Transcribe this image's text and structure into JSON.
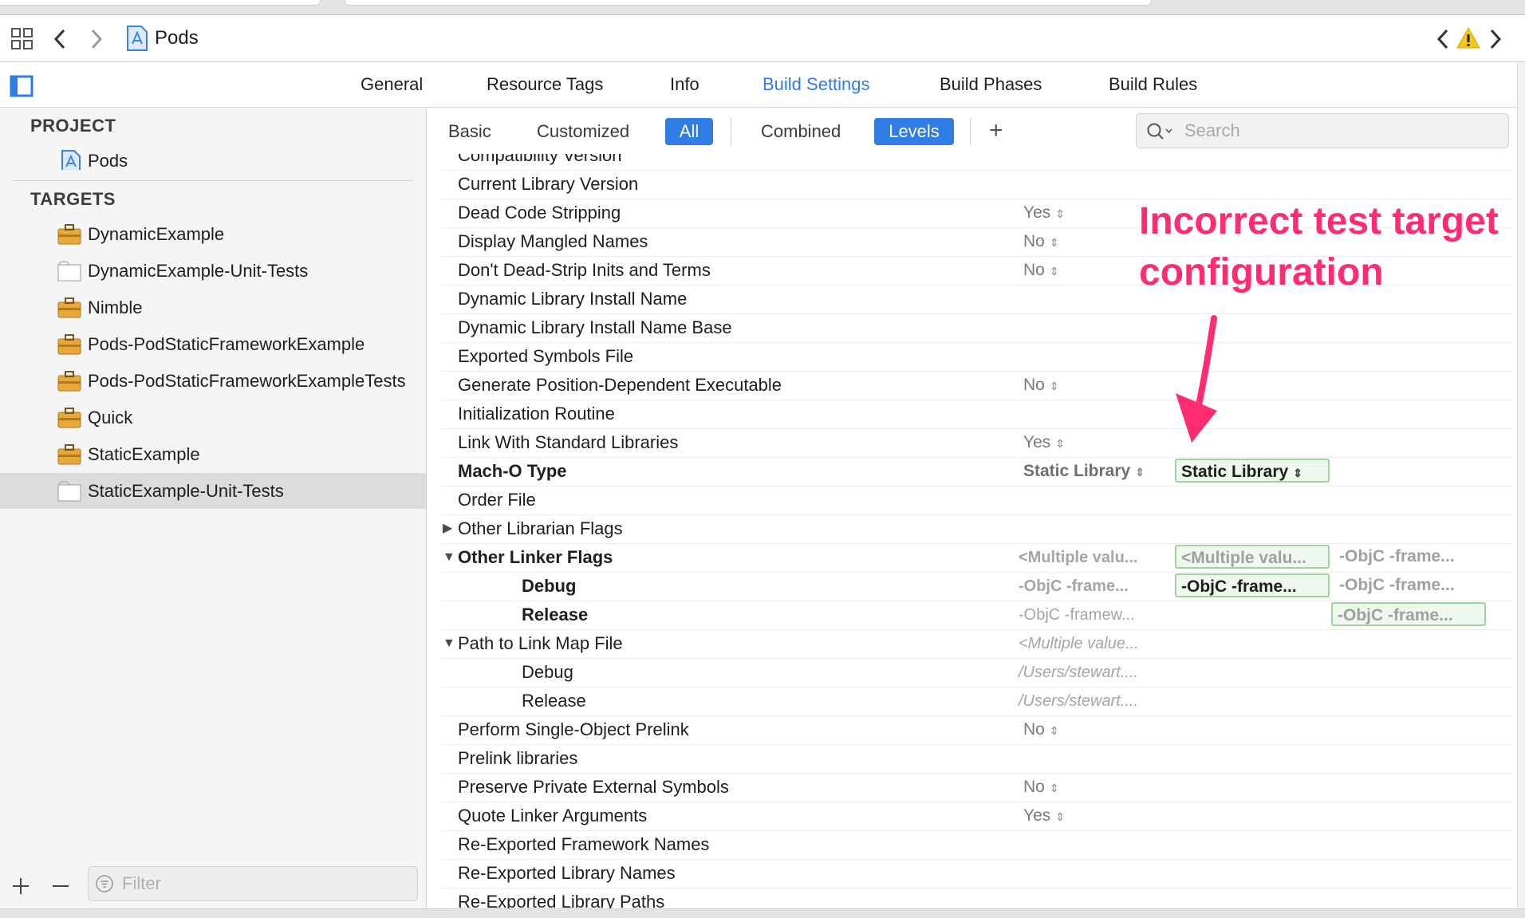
{
  "nav": {
    "title": "Pods"
  },
  "tabs": [
    "General",
    "Resource Tags",
    "Info",
    "Build Settings",
    "Build Phases",
    "Build Rules"
  ],
  "sidebar": {
    "project_header": "PROJECT",
    "project_item": "Pods",
    "targets_header": "TARGETS",
    "targets": [
      "DynamicExample",
      "DynamicExample-Unit-Tests",
      "Nimble",
      "Pods-PodStaticFrameworkExample",
      "Pods-PodStaticFrameworkExampleTests",
      "Quick",
      "StaticExample",
      "StaticExample-Unit-Tests"
    ],
    "filter_placeholder": "Filter"
  },
  "filterbar": {
    "basic": "Basic",
    "customized": "Customized",
    "all": "All",
    "combined": "Combined",
    "levels": "Levels",
    "add": "+",
    "search_placeholder": "Search"
  },
  "rows": {
    "r0": "Compatibility Version",
    "r1": "Current Library Version",
    "r2": "Dead Code Stripping",
    "r3": "Display Mangled Names",
    "r4": "Don't Dead-Strip Inits and Terms",
    "r5": "Dynamic Library Install Name",
    "r6": "Dynamic Library Install Name Base",
    "r7": "Exported Symbols File",
    "r8": "Generate Position-Dependent Executable",
    "r9": "Initialization Routine",
    "r10": "Link With Standard Libraries",
    "r11": "Mach-O Type",
    "r12": "Order File",
    "r13": "Other Librarian Flags",
    "r14": "Other Linker Flags",
    "r15": "Debug",
    "r16": "Release",
    "r17": "Path to Link Map File",
    "r18": "Debug",
    "r19": "Release",
    "r20": "Perform Single-Object Prelink",
    "r21": "Prelink libraries",
    "r22": "Preserve Private External Symbols",
    "r23": "Quote Linker Arguments",
    "r24": "Re-Exported Framework Names",
    "r25": "Re-Exported Library Names",
    "r26": "Re-Exported Library Paths"
  },
  "values": {
    "dead_code": "Yes",
    "mangled": "No",
    "dont_dead_strip": "No",
    "position_dep": "No",
    "link_std": "Yes",
    "macho_resolved": "Static Library",
    "macho_target": "Static Library",
    "olf_resolved": "<Multiple valu...",
    "olf_target": "<Multiple valu...",
    "olf_project": "-ObjC -frame...",
    "olf_debug_resolved": "-ObjC -frame...",
    "olf_debug_target": "-ObjC -frame...",
    "olf_debug_project": "-ObjC -frame...",
    "olf_release_resolved": "-ObjC -framew...",
    "olf_release_project": "-ObjC -frame...",
    "linkmap_resolved": "<Multiple value...",
    "linkmap_debug": "/Users/stewart....",
    "linkmap_release": "/Users/stewart....",
    "single_prelink": "No",
    "preserve_private": "No",
    "quote_args": "Yes"
  },
  "annotation": {
    "line1": "Incorrect test target",
    "line2": "configuration",
    "color": "#ff2d70"
  },
  "colors": {
    "accent": "#2f7ce4",
    "highlight_border": "#9ed39e"
  }
}
